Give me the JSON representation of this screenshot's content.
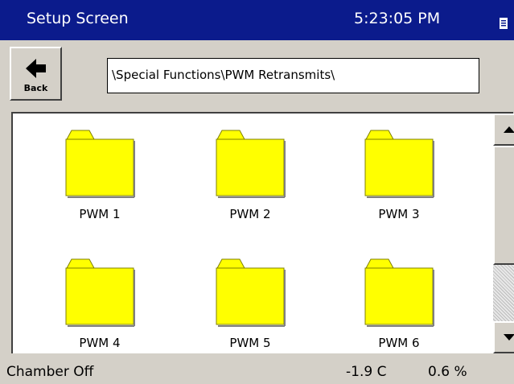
{
  "title_bar": {
    "title": "Setup Screen",
    "time": "5:23:05 PM",
    "icon": "page-menu-icon"
  },
  "toolbar": {
    "back_label": "Back",
    "back_icon": "back-arrow-icon",
    "path": "\\Special Functions\\PWM Retransmits\\"
  },
  "folders": [
    {
      "label": "PWM 1",
      "icon": "folder-icon"
    },
    {
      "label": "PWM 2",
      "icon": "folder-icon"
    },
    {
      "label": "PWM 3",
      "icon": "folder-icon"
    },
    {
      "label": "PWM 4",
      "icon": "folder-icon"
    },
    {
      "label": "PWM 5",
      "icon": "folder-icon"
    },
    {
      "label": "PWM 6",
      "icon": "folder-icon"
    }
  ],
  "scrollbar": {
    "up_icon": "scroll-up-icon",
    "down_icon": "scroll-down-icon"
  },
  "status_bar": {
    "chamber_status": "Chamber Off",
    "temperature": "-1.9 C",
    "percent": "0.6 %"
  },
  "colors": {
    "title_bar": "#0b1b8c",
    "folder_fill": "#ffff00",
    "chrome": "#d4d0c8"
  }
}
